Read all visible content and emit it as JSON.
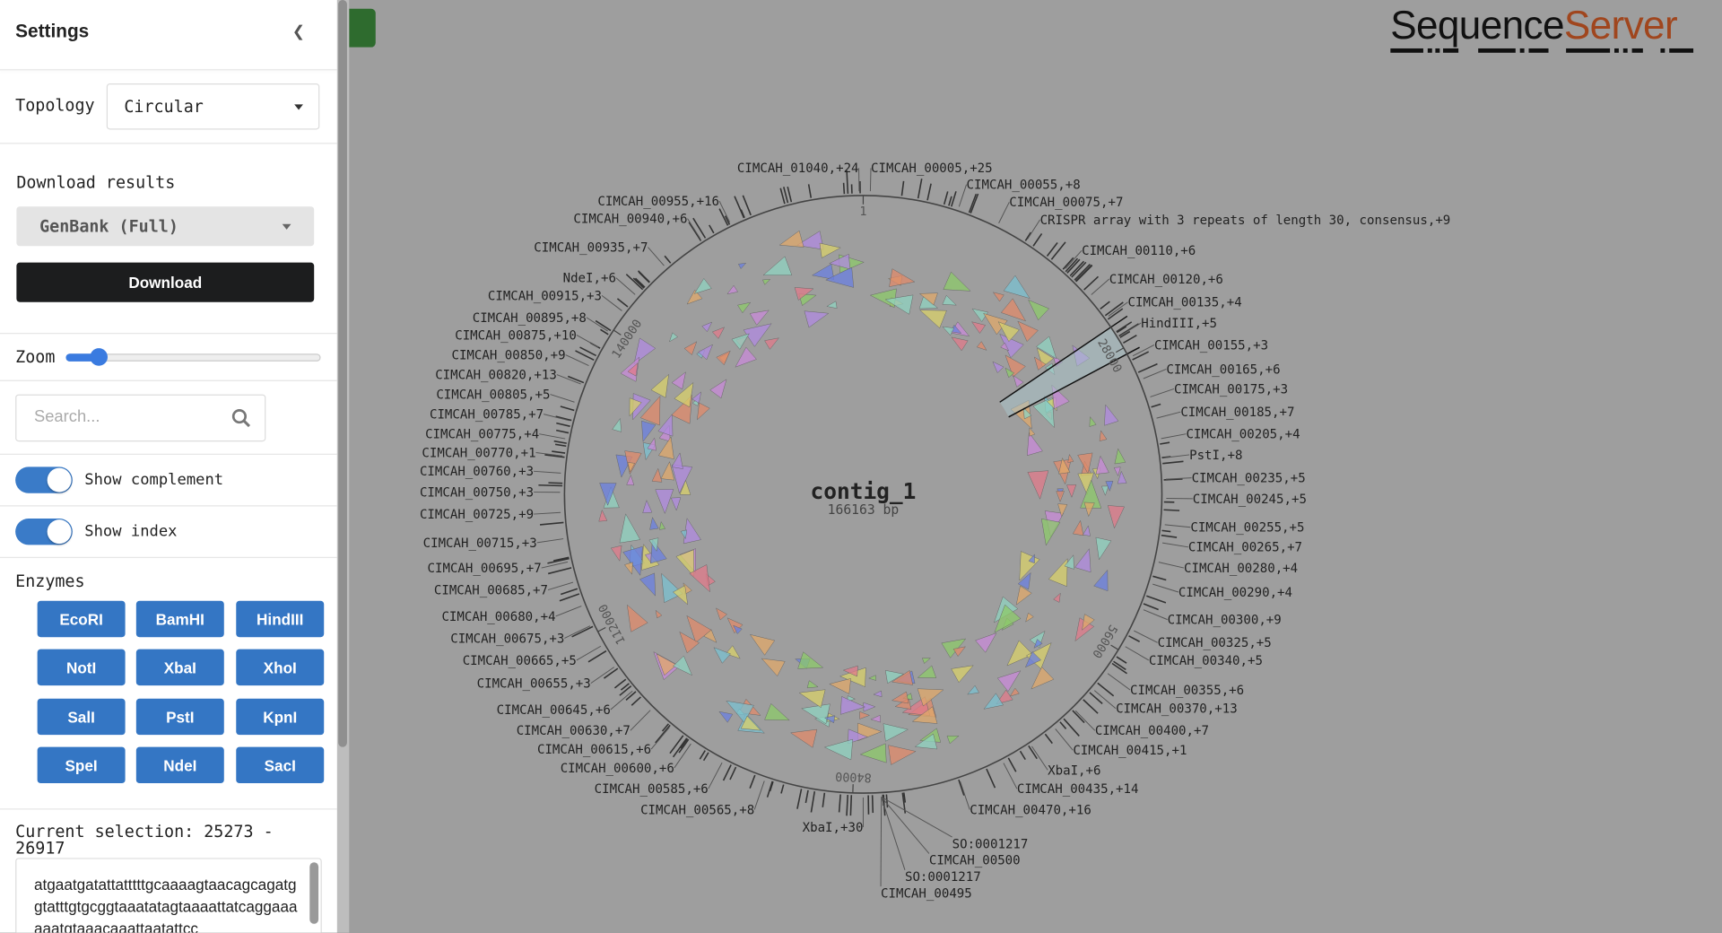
{
  "sidebar": {
    "title": "Settings",
    "collapse_icon": "chevron-left-icon",
    "topology_label": "Topology",
    "topology_value": "Circular",
    "download_heading": "Download results",
    "download_format": "GenBank (Full)",
    "download_button": "Download",
    "zoom_label": "Zoom",
    "zoom_level_fraction": 0.13,
    "search_placeholder": "Search...",
    "show_complement_label": "Show complement",
    "show_complement_on": true,
    "show_index_label": "Show index",
    "show_index_on": true,
    "enzymes_heading": "Enzymes",
    "enzymes": [
      "EcoRI",
      "BamHI",
      "HindIII",
      "NotI",
      "XbaI",
      "XhoI",
      "SalI",
      "PstI",
      "KpnI",
      "SpeI",
      "NdeI",
      "SacI"
    ],
    "selection_label": "Current selection: 25273 - 26917",
    "selection_sequence": "atgaatgatattatttttgcaaaagtaacagcagatggtatttgtgcggtaaatatagtaaaattatcaggaaaaaatgtaaacaaattaatattcc"
  },
  "logo": {
    "part1": "Sequence",
    "part2": "Server",
    "color1": "#111111",
    "color2": "#a0461e"
  },
  "map": {
    "name": "contig_1",
    "length": "166163 bp",
    "index_labels": [
      "1",
      "28000",
      "56000",
      "84000",
      "112000",
      "140000"
    ],
    "selection_color": "#a9c6cc",
    "labels_left": [
      "CIMCAH_01040,+24",
      "CIMCAH_00955,+16",
      "CIMCAH_00940,+6",
      "CIMCAH_00935,+7",
      "NdeI,+6",
      "CIMCAH_00915,+3",
      "CIMCAH_00895,+8",
      "CIMCAH_00875,+10",
      "CIMCAH_00850,+9",
      "CIMCAH_00820,+13",
      "CIMCAH_00805,+5",
      "CIMCAH_00785,+7",
      "CIMCAH_00775,+4",
      "CIMCAH_00770,+1",
      "CIMCAH_00760,+3",
      "CIMCAH_00750,+3",
      "CIMCAH_00725,+9",
      "CIMCAH_00715,+3",
      "CIMCAH_00695,+7",
      "CIMCAH_00685,+7",
      "CIMCAH_00680,+4",
      "CIMCAH_00675,+3",
      "CIMCAH_00665,+5",
      "CIMCAH_00655,+3",
      "CIMCAH_00645,+6",
      "CIMCAH_00630,+7",
      "CIMCAH_00615,+6",
      "CIMCAH_00600,+6",
      "CIMCAH_00585,+6",
      "CIMCAH_00565,+8",
      "XbaI,+30"
    ],
    "labels_right": [
      "CIMCAH_00005,+25",
      "CIMCAH_00055,+8",
      "CIMCAH_00075,+7",
      "CRISPR array with 3 repeats of length 30, consensus,+9",
      "CIMCAH_00110,+6",
      "CIMCAH_00120,+6",
      "CIMCAH_00135,+4",
      "HindIII,+5",
      "CIMCAH_00155,+3",
      "CIMCAH_00165,+6",
      "CIMCAH_00175,+3",
      "CIMCAH_00185,+7",
      "CIMCAH_00205,+4",
      "PstI,+8",
      "CIMCAH_00235,+5",
      "CIMCAH_00245,+5",
      "CIMCAH_00255,+5",
      "CIMCAH_00265,+7",
      "CIMCAH_00280,+4",
      "CIMCAH_00290,+4",
      "CIMCAH_00300,+9",
      "CIMCAH_00325,+5",
      "CIMCAH_00340,+5",
      "CIMCAH_00355,+6",
      "CIMCAH_00370,+13",
      "CIMCAH_00400,+7",
      "CIMCAH_00415,+1",
      "XbaI,+6",
      "CIMCAH_00435,+14",
      "CIMCAH_00470,+16",
      "SO:0001217",
      "CIMCAH_00500",
      "SO:0001217",
      "CIMCAH_00495"
    ],
    "feature_colors": [
      "#8fd3c0",
      "#e08a6a",
      "#c88ad8",
      "#6a7fe0",
      "#8cc96a",
      "#d8d06a",
      "#e07a8a",
      "#b08ae0",
      "#7ac0d0",
      "#e0a86a"
    ]
  }
}
